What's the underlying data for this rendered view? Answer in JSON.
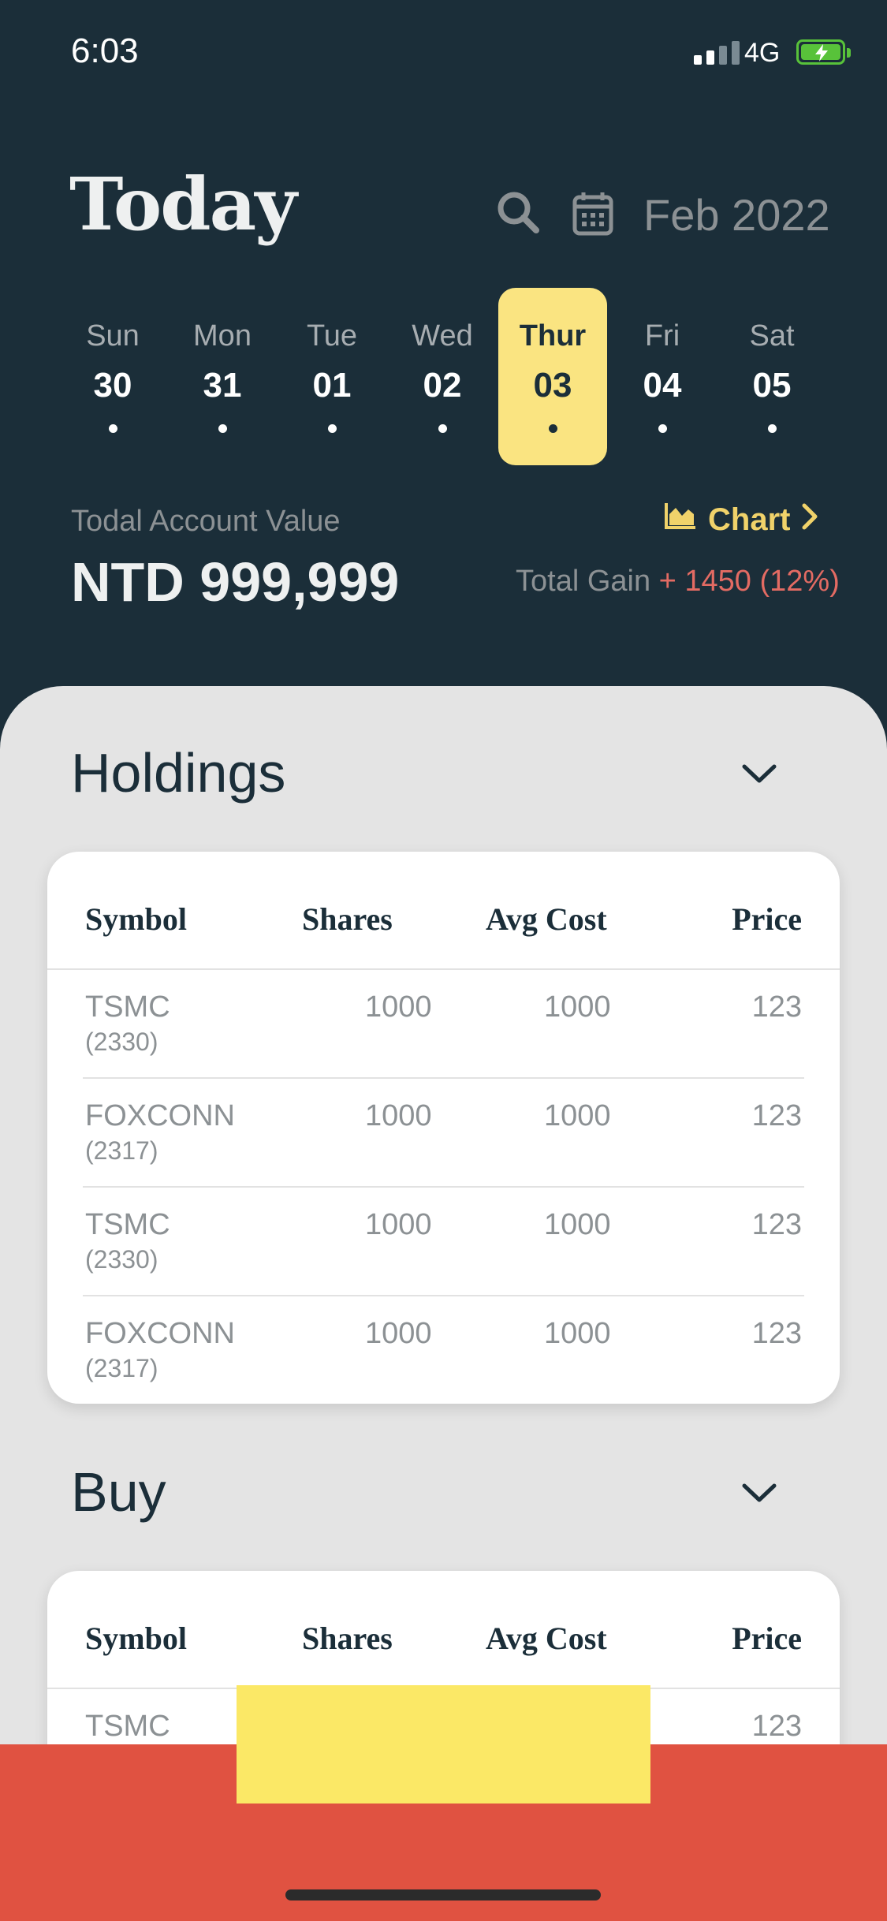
{
  "status_bar": {
    "time": "6:03",
    "network": "4G"
  },
  "header": {
    "title": "Today",
    "month": "Feb 2022"
  },
  "week": [
    {
      "name": "Sun",
      "date": "30",
      "selected": false
    },
    {
      "name": "Mon",
      "date": "31",
      "selected": false
    },
    {
      "name": "Tue",
      "date": "01",
      "selected": false
    },
    {
      "name": "Wed",
      "date": "02",
      "selected": false
    },
    {
      "name": "Thur",
      "date": "03",
      "selected": true
    },
    {
      "name": "Fri",
      "date": "04",
      "selected": false
    },
    {
      "name": "Sat",
      "date": "05",
      "selected": false
    }
  ],
  "account": {
    "label": "Todal Account Value",
    "value": "NTD 999,999",
    "chart_label": "Chart",
    "gain_label": "Total Gain",
    "gain_value": "+ 1450 (12%)"
  },
  "holdings": {
    "title": "Holdings",
    "columns": [
      "Symbol",
      "Shares",
      "Avg Cost",
      "Price"
    ],
    "rows": [
      {
        "symbol": "TSMC",
        "code": "(2330)",
        "shares": "1000",
        "avg_cost": "1000",
        "price": "123"
      },
      {
        "symbol": "FOXCONN",
        "code": "(2317)",
        "shares": "1000",
        "avg_cost": "1000",
        "price": "123"
      },
      {
        "symbol": "TSMC",
        "code": "(2330)",
        "shares": "1000",
        "avg_cost": "1000",
        "price": "123"
      },
      {
        "symbol": "FOXCONN",
        "code": "(2317)",
        "shares": "1000",
        "avg_cost": "1000",
        "price": "123"
      }
    ]
  },
  "buy": {
    "title": "Buy",
    "columns": [
      "Symbol",
      "Shares",
      "Avg Cost",
      "Price"
    ],
    "rows": [
      {
        "symbol": "TSMC",
        "price": "123"
      }
    ]
  },
  "colors": {
    "background": "#1b2e39",
    "accent_yellow": "#fae481",
    "gain_red": "#e36b63",
    "bottom_bar": "#e05241"
  }
}
